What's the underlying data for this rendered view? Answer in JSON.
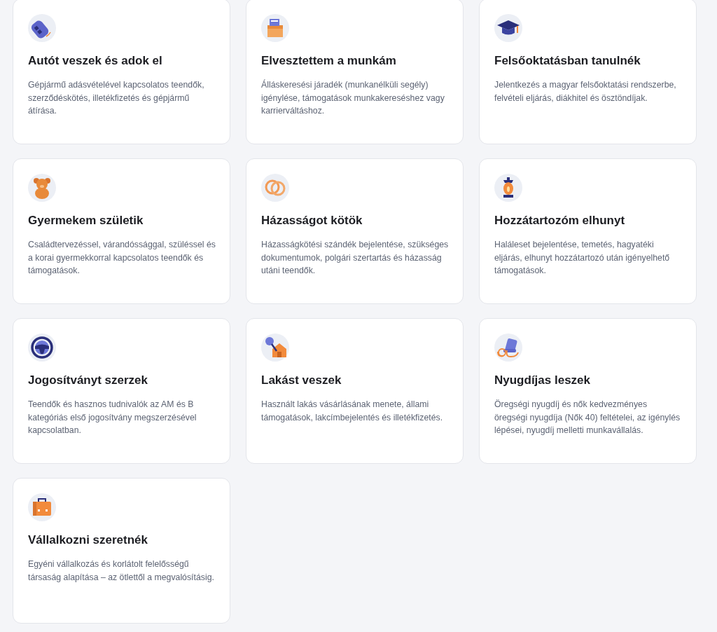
{
  "cards": [
    {
      "title": "Autót veszek és adok el",
      "description": "Gépjármű adásvételével kapcsolatos teendők, szerződéskötés, illetékfizetés és gépjármű átírása."
    },
    {
      "title": "Elvesztettem a munkám",
      "description": "Álláskeresési járadék (munkanélküli segély) igénylése, támogatások munkakereséshez vagy karrierváltáshoz."
    },
    {
      "title": "Felsőoktatásban tanulnék",
      "description": "Jelentkezés a magyar felsőoktatási rendszerbe, felvételi eljárás, diákhitel és ösztöndíjak."
    },
    {
      "title": "Gyermekem születik",
      "description": "Családtervezéssel, várandóssággal, szüléssel és a korai gyermekkorral kapcsolatos teendők és támogatások."
    },
    {
      "title": "Házasságot kötök",
      "description": "Házasságkötési szándék bejelentése, szükséges dokumentumok, polgári szertartás és házasság utáni teendők."
    },
    {
      "title": "Hozzátartozóm elhunyt",
      "description": "Haláleset bejelentése, temetés, hagyatéki eljárás, elhunyt hozzátartozó után igényelhető támogatások."
    },
    {
      "title": "Jogosítványt szerzek",
      "description": "Teendők és hasznos tudnivalók az AM és B kategóriás első jogosítvány megszerzésével kapcsolatban."
    },
    {
      "title": "Lakást veszek",
      "description": "Használt lakás vásárlásának menete, állami támogatások, lakcímbejelentés és illetékfizetés."
    },
    {
      "title": "Nyugdíjas leszek",
      "description": "Öregségi nyugdíj és nők kedvezményes öregségi nyugdíja (Nők 40) feltételei, az igénylés lépései, nyugdíj melletti munkavállalás."
    },
    {
      "title": "Vállalkozni szeretnék",
      "description": "Egyéni vállalkozás és korlátolt felelősségű társaság alapítása – az ötlettől a megvalósításig."
    }
  ]
}
